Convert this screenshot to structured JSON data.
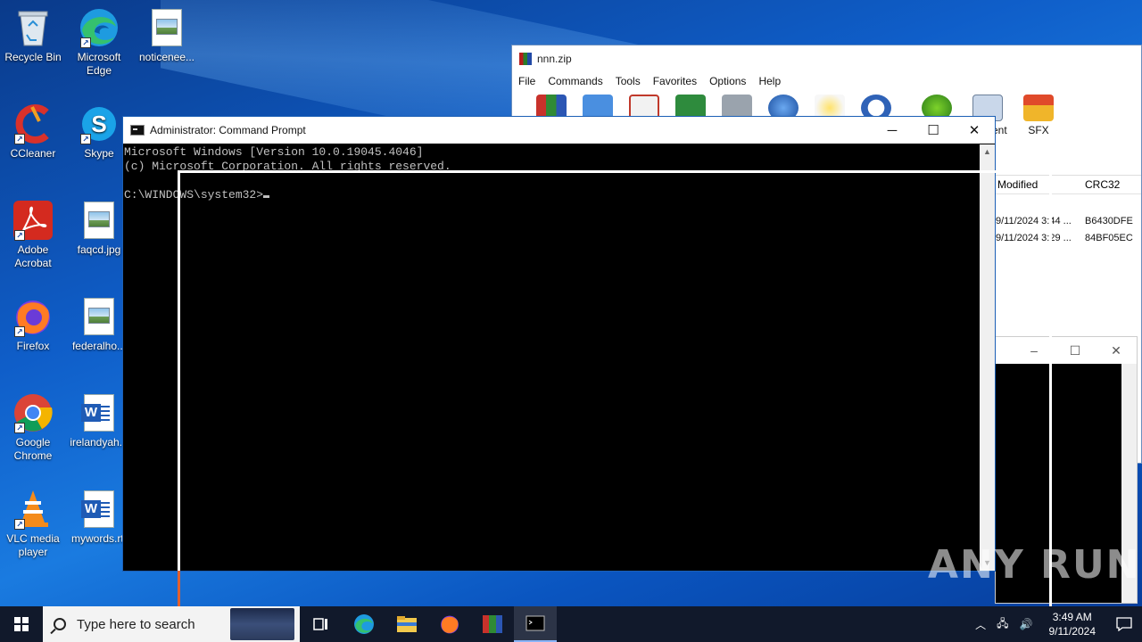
{
  "desktop": {
    "icons": [
      {
        "label": "Recycle Bin"
      },
      {
        "label": "Microsoft Edge"
      },
      {
        "label": "noticenee..."
      },
      {
        "label": "CCleaner"
      },
      {
        "label": "Skype"
      },
      {
        "label": "Adobe Acrobat"
      },
      {
        "label": "faqcd.jpg"
      },
      {
        "label": "Firefox"
      },
      {
        "label": "federalho..."
      },
      {
        "label": "Google Chrome"
      },
      {
        "label": "irelandyah..."
      },
      {
        "label": "VLC media player"
      },
      {
        "label": "mywords.rtf"
      }
    ]
  },
  "winrar": {
    "title": "nnn.zip",
    "menu": [
      "File",
      "Commands",
      "Tools",
      "Favorites",
      "Options",
      "Help"
    ],
    "toolbar_visible_labels": [
      "omment",
      "SFX"
    ],
    "columns": [
      "Modified",
      "CRC32"
    ],
    "rows": [
      {
        "modified": "9/11/2024 3:44 ...",
        "crc": "B6430DFE"
      },
      {
        "modified": "9/11/2024 3:29 ...",
        "crc": "84BF05EC"
      }
    ]
  },
  "cmd": {
    "title": "Administrator: Command Prompt",
    "lines": [
      "Microsoft Windows [Version 10.0.19045.4046]",
      "(c) Microsoft Corporation. All rights reserved.",
      "",
      "C:\\WINDOWS\\system32>"
    ]
  },
  "taskbar": {
    "search_placeholder": "Type here to search",
    "time": "3:49 AM",
    "date": "9/11/2024"
  },
  "watermark": "ANY RUN",
  "colors": {
    "desktop": "#0f5ec9",
    "taskbar": "#11192b",
    "console_bg": "#000000",
    "console_text": "#c0c0c0"
  }
}
